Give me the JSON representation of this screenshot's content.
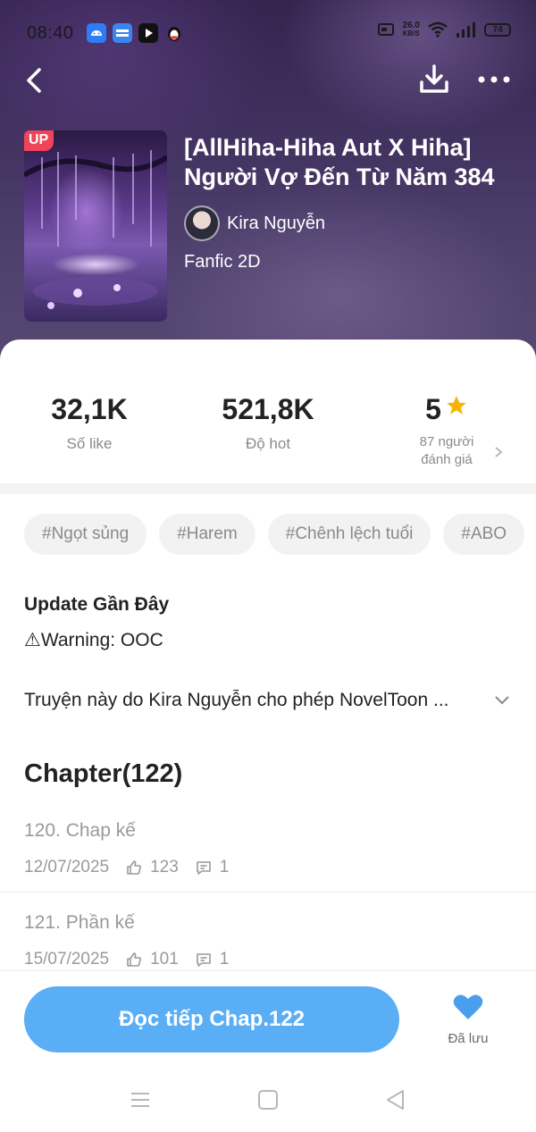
{
  "status_bar": {
    "time": "08:40",
    "net_speed_value": "26.0",
    "net_speed_unit": "KB/S",
    "battery": "74",
    "app_icons": [
      "android-icon",
      "noveltoon-icon",
      "video-icon",
      "penguin-icon"
    ]
  },
  "book": {
    "badge": "UP",
    "title": "[AllHiha-Hiha Aut X Hiha] Người Vợ Đến Từ Năm 384",
    "author": "Kira Nguyễn",
    "genre": "Fanfic 2D"
  },
  "stats": {
    "likes_value": "32,1K",
    "likes_label": "Số like",
    "hot_value": "521,8K",
    "hot_label": "Độ hot",
    "rating_value": "5",
    "rating_count_line1": "87 người",
    "rating_count_line2": "đánh giá"
  },
  "tags": [
    "#Ngọt sủng",
    "#Harem",
    "#Chênh lệch tuổi",
    "#ABO"
  ],
  "update": {
    "title": "Update Gần Đây",
    "body": "⚠Warning: OOC"
  },
  "description": "Truyện này do Kira Nguyễn cho phép NovelToon ...",
  "chapter_header": "Chapter(122)",
  "chapters": [
    {
      "title": "120. Chap kế",
      "date": "12/07/2025",
      "likes": "123",
      "comments": "1"
    },
    {
      "title": "121. Phần kế",
      "date": "15/07/2025",
      "likes": "101",
      "comments": "1"
    }
  ],
  "actions": {
    "continue_label": "Đọc tiếp Chap.122",
    "saved_label": "Đã lưu"
  },
  "colors": {
    "accent": "#5aaef5",
    "badge": "#f0445a",
    "star": "#f7b500"
  }
}
